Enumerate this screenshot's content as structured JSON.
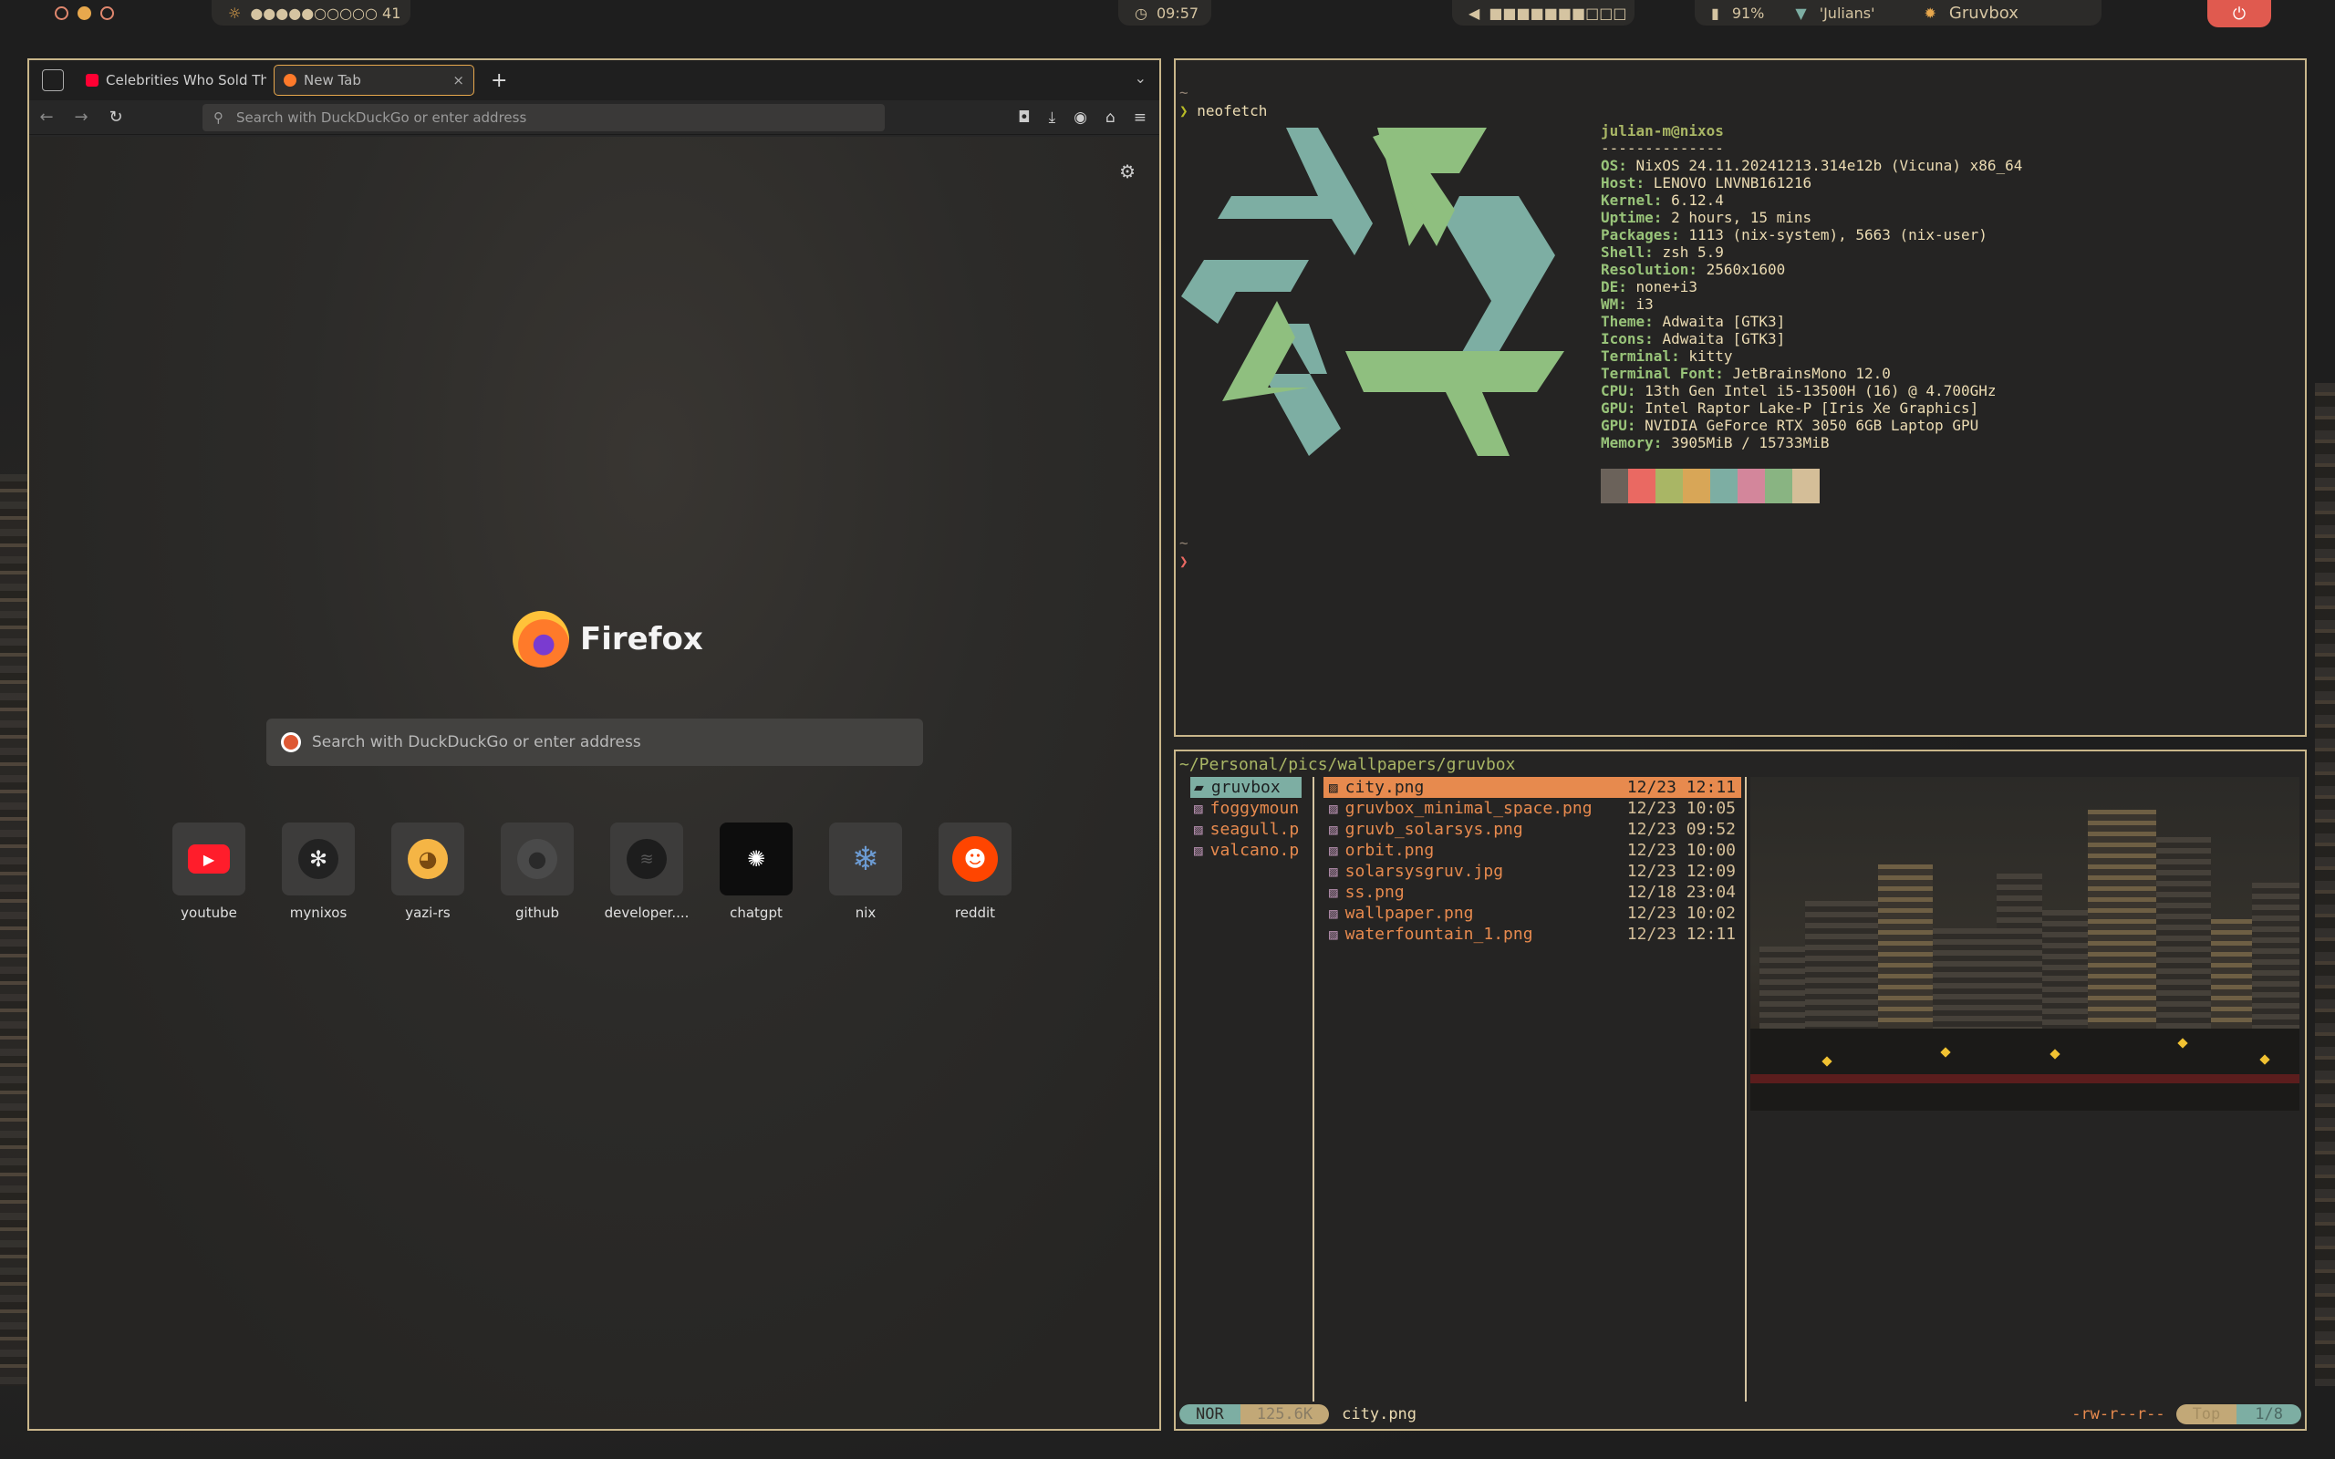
{
  "topbar": {
    "brightness": "●●●●●○○○○○ 41",
    "clock": "09:57",
    "volume": "■■■■■■■□□□",
    "battery": "91%",
    "wifi": "'Julians'",
    "theme": "Gruvbox"
  },
  "firefox": {
    "tabs": [
      {
        "label": "Celebrities Who Sold The",
        "favicon_color": "#ff0033"
      },
      {
        "label": "New Tab",
        "favicon_color": "#ff7a2a"
      }
    ],
    "url_placeholder": "Search with DuckDuckGo or enter address",
    "brand": "Firefox",
    "search_placeholder": "Search with DuckDuckGo or enter address",
    "shortcuts": [
      {
        "label": "youtube",
        "icon": "youtube-icon"
      },
      {
        "label": "mynixos",
        "icon": "gear-icon"
      },
      {
        "label": "yazi-rs",
        "icon": "duck-icon"
      },
      {
        "label": "github",
        "icon": "github-icon"
      },
      {
        "label": "developer....",
        "icon": "spotify-icon"
      },
      {
        "label": "chatgpt",
        "icon": "chatgpt-icon"
      },
      {
        "label": "nix",
        "icon": "nix-snowflake-icon"
      },
      {
        "label": "reddit",
        "icon": "reddit-icon"
      }
    ]
  },
  "terminal": {
    "tilde": "~",
    "prompt": "❯",
    "command": "neofetch",
    "user_host": "julian-m@nixos",
    "separator": "--------------",
    "info": [
      {
        "key": "OS",
        "value": "NixOS 24.11.20241213.314e12b (Vicuna) x86_64"
      },
      {
        "key": "Host",
        "value": "LENOVO LNVNB161216"
      },
      {
        "key": "Kernel",
        "value": "6.12.4"
      },
      {
        "key": "Uptime",
        "value": "2 hours, 15 mins"
      },
      {
        "key": "Packages",
        "value": "1113 (nix-system), 5663 (nix-user)"
      },
      {
        "key": "Shell",
        "value": "zsh 5.9"
      },
      {
        "key": "Resolution",
        "value": "2560x1600"
      },
      {
        "key": "DE",
        "value": "none+i3"
      },
      {
        "key": "WM",
        "value": "i3"
      },
      {
        "key": "Theme",
        "value": "Adwaita [GTK3]"
      },
      {
        "key": "Icons",
        "value": "Adwaita [GTK3]"
      },
      {
        "key": "Terminal",
        "value": "kitty"
      },
      {
        "key": "Terminal Font",
        "value": "JetBrainsMono 12.0"
      },
      {
        "key": "CPU",
        "value": "13th Gen Intel i5-13500H (16) @ 4.700GHz"
      },
      {
        "key": "GPU",
        "value": "Intel Raptor Lake-P [Iris Xe Graphics]"
      },
      {
        "key": "GPU",
        "value": "NVIDIA GeForce RTX 3050 6GB Laptop GPU"
      },
      {
        "key": "Memory",
        "value": "3905MiB / 15733MiB"
      }
    ],
    "palette": [
      "#6b625a",
      "#ea6962",
      "#a9b665",
      "#d8a657",
      "#7daea3",
      "#d3869b",
      "#89b482",
      "#d4be98"
    ]
  },
  "filemanager": {
    "path": "~/Personal/pics/wallpapers/gruvbox",
    "parent_items": [
      {
        "name": "gruvbox",
        "type": "folder",
        "selected": true
      },
      {
        "name": "foggymoun",
        "type": "image",
        "selected": false
      },
      {
        "name": "seagull.p",
        "type": "image",
        "selected": false
      },
      {
        "name": "valcano.p",
        "type": "image",
        "selected": false
      }
    ],
    "files": [
      {
        "name": "city.png",
        "date": "12/23 12:11",
        "selected": true
      },
      {
        "name": "gruvbox_minimal_space.png",
        "date": "12/23 10:05",
        "selected": false
      },
      {
        "name": "gruvb_solarsys.png",
        "date": "12/23 09:52",
        "selected": false
      },
      {
        "name": "orbit.png",
        "date": "12/23 10:00",
        "selected": false
      },
      {
        "name": "solarsysgruv.jpg",
        "date": "12/23 12:09",
        "selected": false
      },
      {
        "name": "ss.png",
        "date": "12/18 23:04",
        "selected": false
      },
      {
        "name": "wallpaper.png",
        "date": "12/23 10:02",
        "selected": false
      },
      {
        "name": "waterfountain_1.png",
        "date": "12/23 12:11",
        "selected": false
      }
    ],
    "status": {
      "mode": "NOR",
      "size": "125.6K",
      "filename": "city.png",
      "permissions": "-rw-r--r--",
      "position": "Top",
      "count": "1/8"
    }
  }
}
